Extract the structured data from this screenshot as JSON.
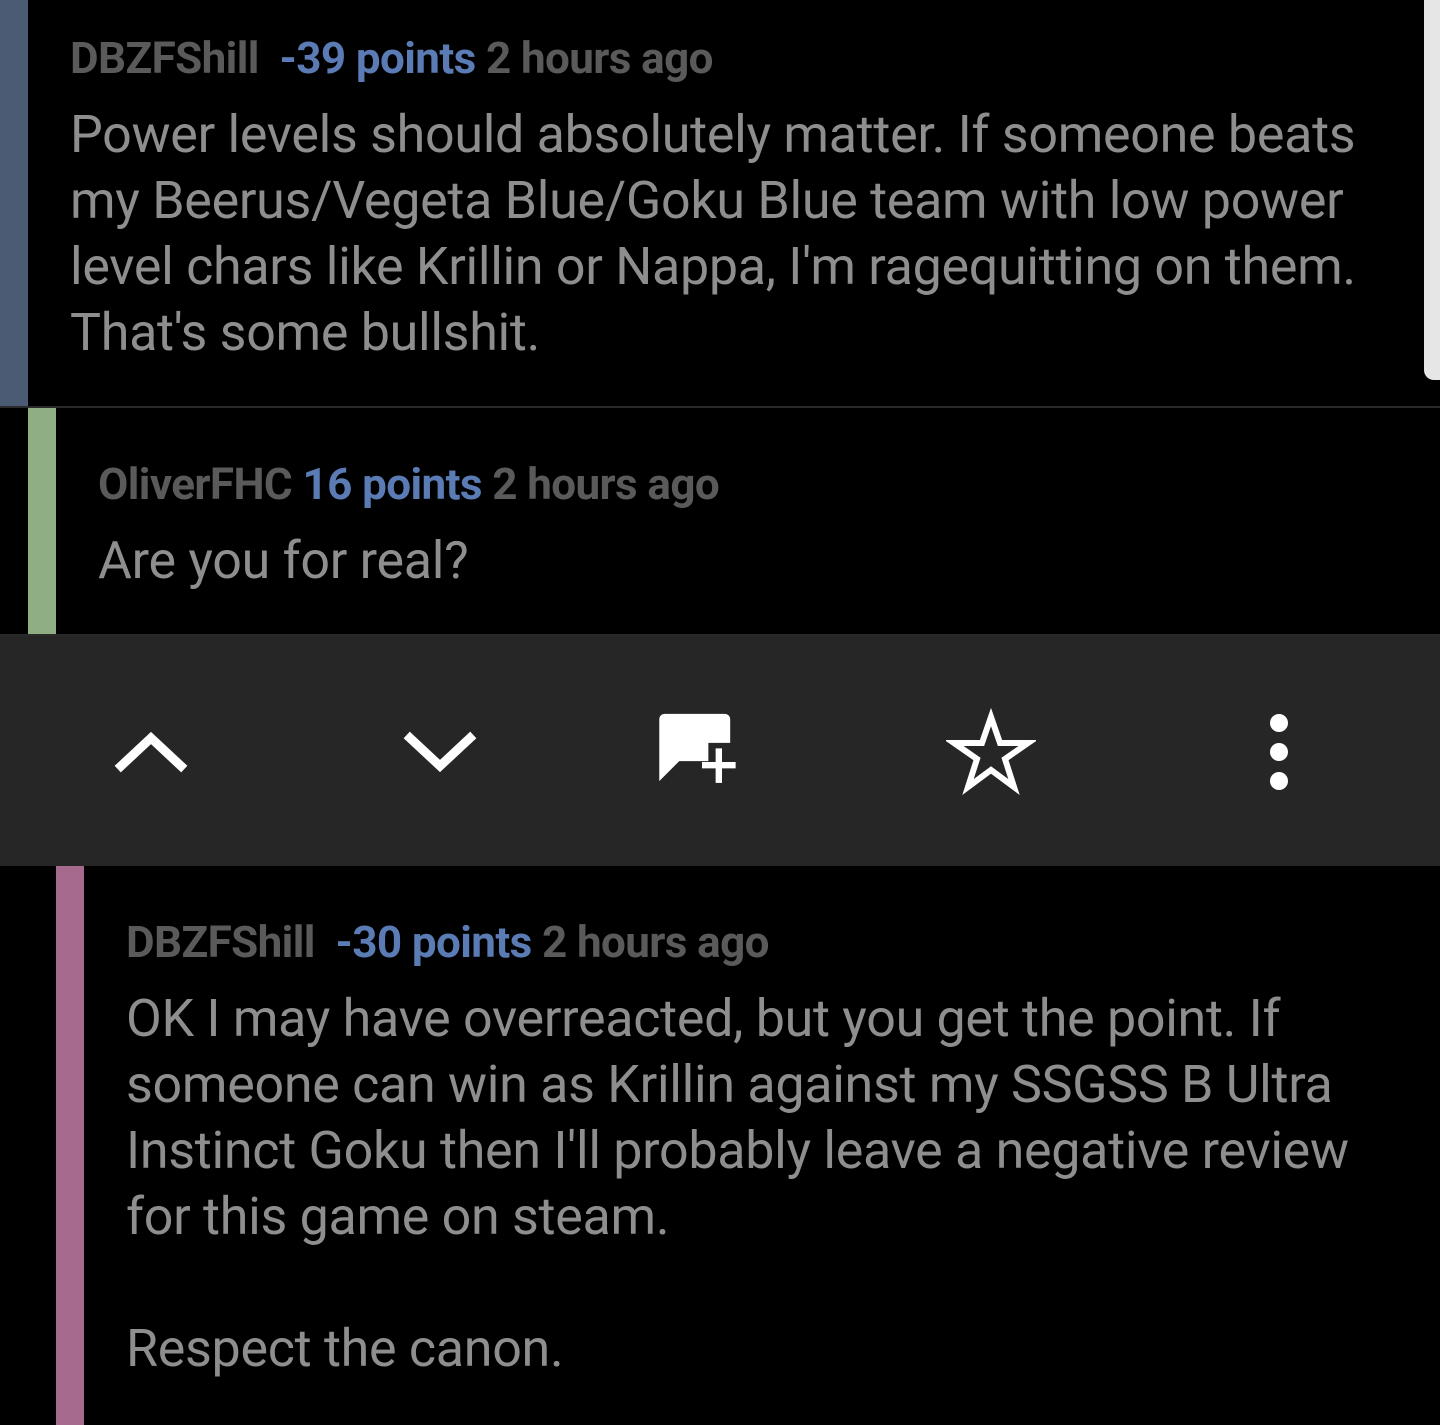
{
  "colors": {
    "background": "#000000",
    "action_bar_bg": "#262626",
    "depth_level_1": "#4a5b73",
    "depth_level_2": "#8fae84",
    "depth_level_3": "#a56a8e",
    "points_color": "#5b7bb5",
    "author_color": "#5a5a5a",
    "body_color": "#8e8e8e"
  },
  "comments": [
    {
      "author": "DBZFShill",
      "points": "-39 points",
      "age": "2 hours ago",
      "body": [
        "Power levels should absolutely matter. If someone beats my Beerus/Vegeta Blue/Goku Blue team with low power level chars like Krillin or Nappa, I'm ragequitting on them. That's some bullshit."
      ]
    },
    {
      "author": "OliverFHC",
      "points": "16 points",
      "age": "2 hours ago",
      "body": [
        "Are you for real?"
      ]
    },
    {
      "author": "DBZFShill",
      "points": "-30 points",
      "age": "2 hours ago",
      "body": [
        "OK I may have overreacted, but you get the point. If someone can win as Krillin against my SSGSS B Ultra Instinct Goku then I'll probably leave a negative review for this game on steam.",
        "Respect the canon."
      ]
    }
  ],
  "action_bar": {
    "buttons": [
      {
        "name": "upvote",
        "icon": "chevron-up-icon"
      },
      {
        "name": "downvote",
        "icon": "chevron-down-icon"
      },
      {
        "name": "reply",
        "icon": "comment-add-icon"
      },
      {
        "name": "save",
        "icon": "star-outline-icon"
      },
      {
        "name": "more",
        "icon": "more-vertical-icon"
      }
    ]
  }
}
